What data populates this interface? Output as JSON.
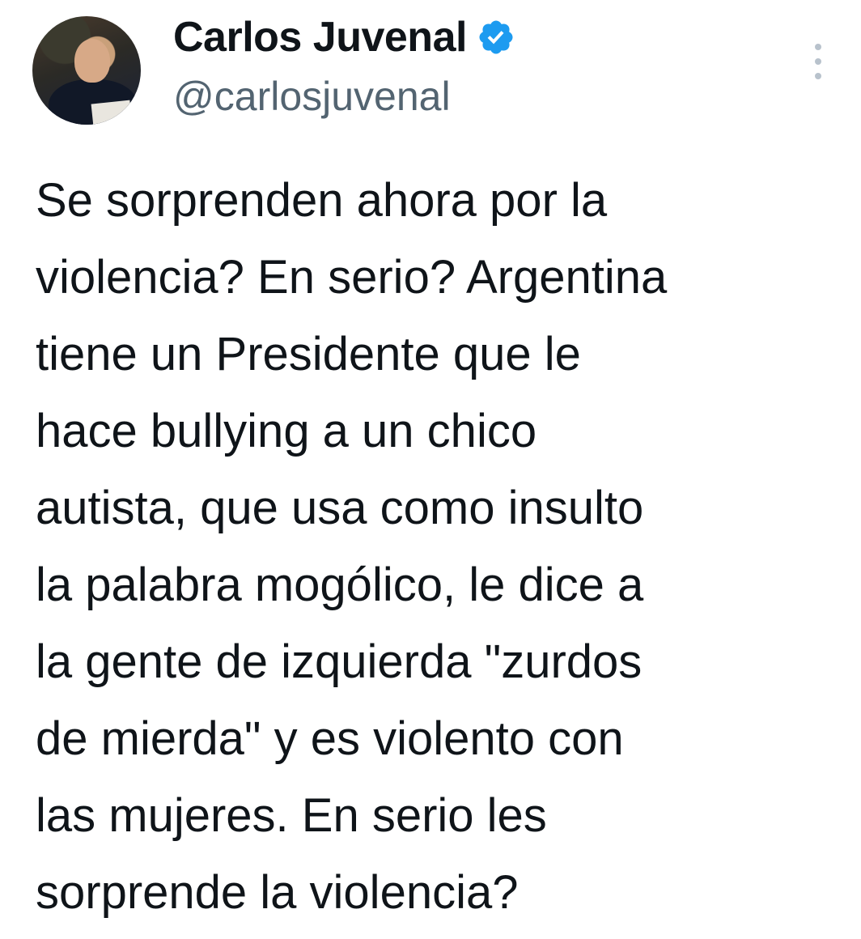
{
  "author": {
    "display_name": "Carlos Juvenal",
    "handle": "@carlosjuvenal",
    "verified": true,
    "verified_color": "#1d9bf0"
  },
  "tweet": {
    "lines": [
      "Se sorprenden ahora por la",
      "violencia? En serio? Argentina",
      "tiene un Presidente que le",
      "hace bullying a un chico",
      "autista, que usa como insulto",
      "la palabra mogólico, le dice a",
      "la gente de izquierda \"zurdos",
      "de mierda\" y es violento con",
      "las mujeres. En serio les",
      "sorprende la violencia?"
    ]
  },
  "icons": {
    "more": "more-vertical-icon",
    "verified": "verified-badge-icon"
  }
}
